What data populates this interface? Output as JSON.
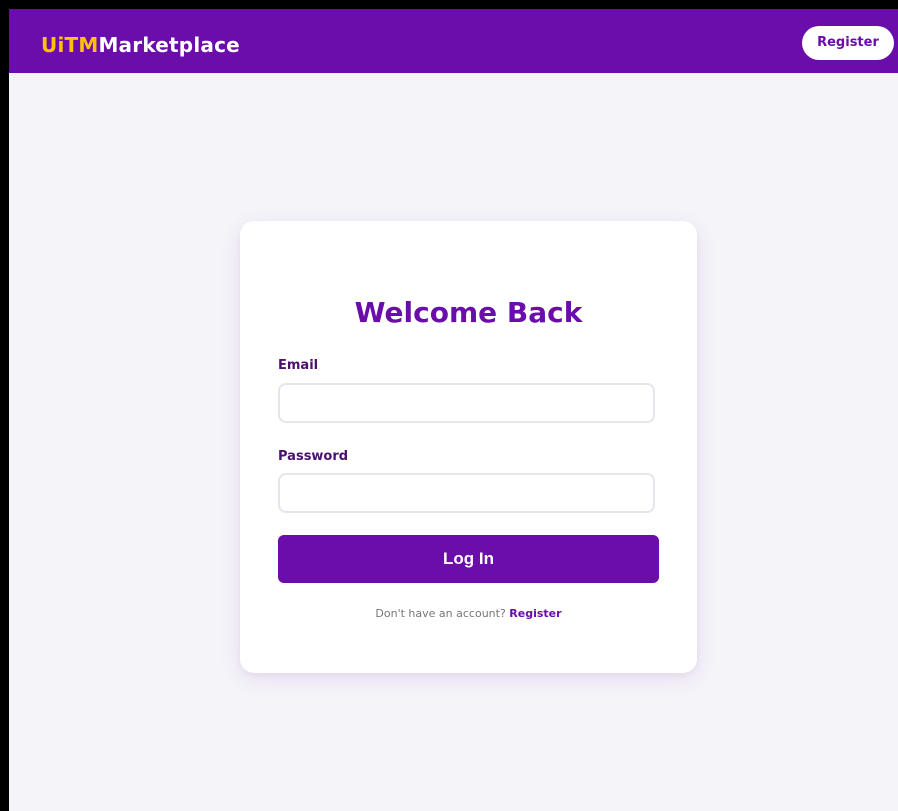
{
  "header": {
    "brand_accent": "UiTM",
    "brand_main": "Marketplace",
    "register_label": "Register"
  },
  "login_card": {
    "title": "Welcome Back",
    "email_label": "Email",
    "email_value": "",
    "password_label": "Password",
    "password_value": "",
    "submit_label": "Log In",
    "signup_prompt": "Don't have an account?",
    "signup_link": "Register"
  },
  "colors": {
    "brand_purple": "#6a0dab",
    "brand_yellow": "#ffc107",
    "page_background": "#f5f4f9",
    "card_background": "#ffffff"
  }
}
